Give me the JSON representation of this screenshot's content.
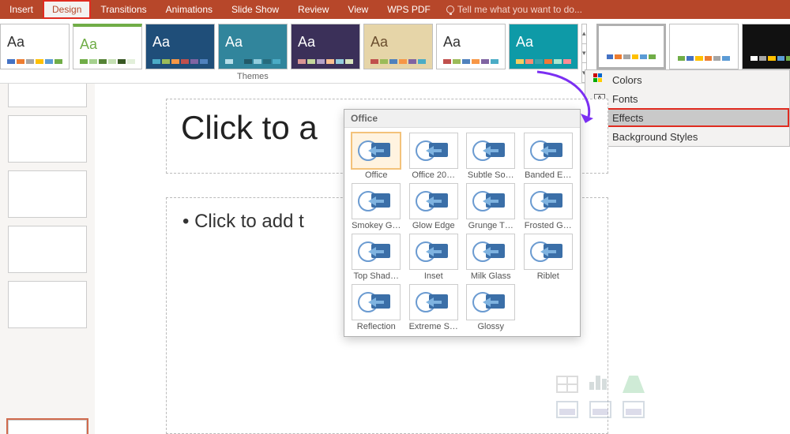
{
  "ribbon": {
    "tabs": [
      "Insert",
      "Design",
      "Transitions",
      "Animations",
      "Slide Show",
      "Review",
      "View",
      "WPS PDF"
    ],
    "active_tab": "Design",
    "tell_me_placeholder": "Tell me what you want to do..."
  },
  "themes_label": "Themes",
  "theme_thumbs": [
    {
      "bg": "#ffffff",
      "fg": "#333",
      "dots": [
        "#4472c4",
        "#ed7d31",
        "#a5a5a5",
        "#ffc000",
        "#5b9bd5",
        "#70ad47"
      ]
    },
    {
      "bg": "#ffffff",
      "fg": "#70ad47",
      "dots": [
        "#70ad47",
        "#a5d18e",
        "#548235",
        "#c5e0b4",
        "#385723",
        "#e2efda"
      ],
      "border": "#70ad47"
    },
    {
      "bg": "#1f4e79",
      "fg": "#fff",
      "dots": [
        "#4bacc6",
        "#9bbb59",
        "#f79646",
        "#c0504d",
        "#8064a2",
        "#4f81bd"
      ],
      "pattern": true
    },
    {
      "bg": "#31859c",
      "fg": "#fff",
      "dots": [
        "#b7dee8",
        "#31859c",
        "#215968",
        "#93cddd",
        "#276a7c",
        "#4bacc6"
      ]
    },
    {
      "bg": "#3b3059",
      "fg": "#fff",
      "dots": [
        "#d99694",
        "#c3d69b",
        "#b3a2c7",
        "#fac090",
        "#93cddd",
        "#d7e4bd"
      ]
    },
    {
      "bg": "#e6d5a8",
      "fg": "#6b4e2e",
      "dots": [
        "#c0504d",
        "#9bbb59",
        "#4f81bd",
        "#f79646",
        "#8064a2",
        "#4bacc6"
      ],
      "wood": true
    },
    {
      "bg": "#ffffff",
      "fg": "#333",
      "dots": [
        "#c0504d",
        "#9bbb59",
        "#4f81bd",
        "#f79646",
        "#8064a2",
        "#4bacc6"
      ]
    },
    {
      "bg": "#0e9aa7",
      "fg": "#fff",
      "dots": [
        "#f6cd61",
        "#fe8a71",
        "#3da4ab",
        "#f37736",
        "#a8e6cf",
        "#ff8b94"
      ],
      "tri": true
    }
  ],
  "variants": [
    {
      "dots": [
        "#4472c4",
        "#ed7d31",
        "#a5a5a5",
        "#ffc000",
        "#5b9bd5",
        "#70ad47"
      ],
      "sel": true
    },
    {
      "dots": [
        "#70ad47",
        "#4472c4",
        "#ffc000",
        "#ed7d31",
        "#a5a5a5",
        "#5b9bd5"
      ]
    },
    {
      "dots": [
        "#ffffff",
        "#a5a5a5",
        "#ffc000",
        "#5b9bd5",
        "#70ad47",
        "#ed7d31"
      ],
      "dark": true
    }
  ],
  "design_menu": {
    "items": [
      {
        "label": "Colors",
        "icon": "colors"
      },
      {
        "label": "Fonts",
        "icon": "fonts"
      },
      {
        "label": "Effects",
        "icon": "effects",
        "selected": true,
        "highlight": true
      },
      {
        "label": "Background Styles",
        "icon": "background"
      }
    ]
  },
  "slide": {
    "title_placeholder": "Click to a",
    "content_placeholder": "Click to add t"
  },
  "effects_gallery": {
    "header": "Office",
    "items": [
      {
        "label": "Office",
        "selected": true
      },
      {
        "label": "Office 20…"
      },
      {
        "label": "Subtle So…"
      },
      {
        "label": "Banded E…"
      },
      {
        "label": "Smokey G…"
      },
      {
        "label": "Glow Edge"
      },
      {
        "label": "Grunge T…"
      },
      {
        "label": "Frosted G…"
      },
      {
        "label": "Top Shad…"
      },
      {
        "label": "Inset"
      },
      {
        "label": "Milk Glass"
      },
      {
        "label": "Riblet"
      },
      {
        "label": "Reflection"
      },
      {
        "label": "Extreme S…"
      },
      {
        "label": "Glossy"
      }
    ]
  }
}
